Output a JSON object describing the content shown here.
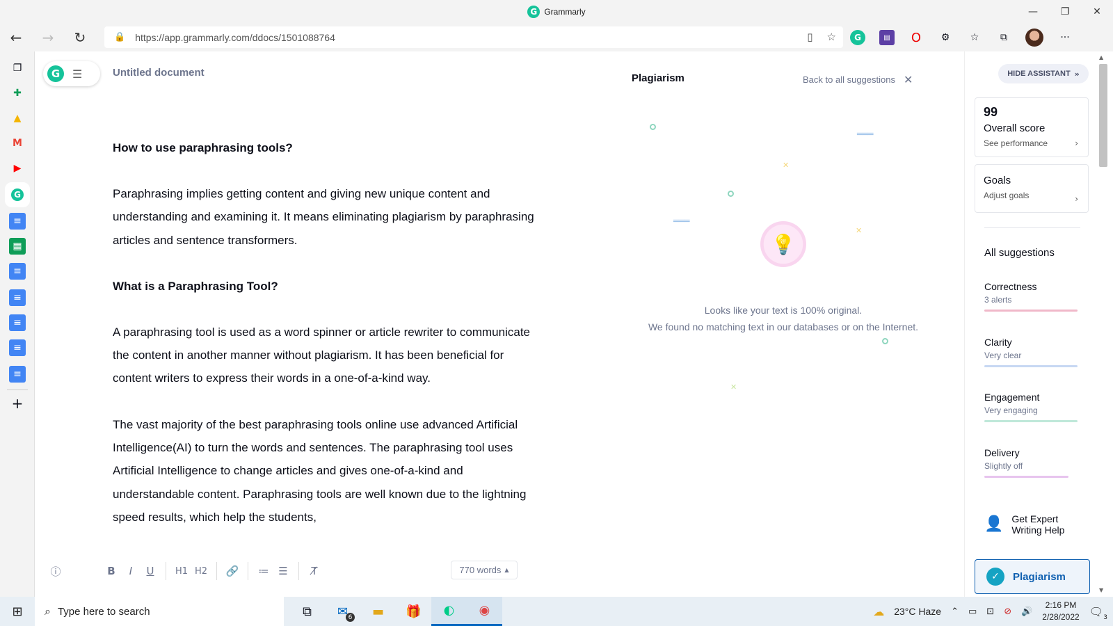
{
  "window": {
    "title": "Grammarly",
    "controls": [
      "—",
      "❐",
      "✕"
    ]
  },
  "browser": {
    "url": "https://app.grammarly.com/ddocs/1501088764",
    "back_icon": "←",
    "forward_icon": "→",
    "reload_icon": "↻",
    "more_icon": "···"
  },
  "extensions": [
    {
      "name": "grammarly-extension-icon",
      "glyph": "G"
    },
    {
      "name": "purple-extension-icon",
      "glyph": "▤"
    },
    {
      "name": "opera-extension-icon",
      "glyph": "O"
    },
    {
      "name": "puzzle-extension-icon",
      "glyph": "⚙"
    }
  ],
  "document": {
    "title": "Untitled document",
    "blocks": [
      {
        "type": "h",
        "text": "How to use paraphrasing tools?"
      },
      {
        "type": "p",
        "text": "Paraphrasing implies getting content and giving new unique content and understanding and examining it. It means eliminating plagiarism by paraphrasing articles and sentence transformers."
      },
      {
        "type": "h",
        "text": "What is a Paraphrasing Tool?"
      },
      {
        "type": "p",
        "text": "A  paraphrasing tool is used as a word spinner or article rewriter to communicate the content in another manner without plagiarism. It has been beneficial for content writers to express their words in a one-of-a-kind way."
      },
      {
        "type": "p",
        "text": "The vast majority of the best paraphrasing tools online use advanced Artificial Intelligence(AI) to turn the words and sentences. The paraphrasing tool uses Artificial Intelligence to change articles and gives one-of-a-kind and understandable content. Paraphrasing tools are well known due to the lightning speed results, which help the students,"
      }
    ],
    "word_count": "770 words",
    "toolbar": {
      "bold": "B",
      "italic": "I",
      "underline": "U",
      "h1": "H1",
      "h2": "H2"
    }
  },
  "plagiarism_panel": {
    "title": "Plagiarism",
    "back_link": "Back to all suggestions",
    "message_line1": "Looks like your text is 100% original.",
    "message_line2": "We found no matching text in our databases or on the Internet."
  },
  "assistant": {
    "hide_label": "HIDE ASSISTANT",
    "score": {
      "value": "99",
      "label": "Overall score",
      "link": "See performance"
    },
    "goals": {
      "label": "Goals",
      "link": "Adjust goals"
    },
    "all_suggestions": "All suggestions",
    "categories": [
      {
        "name": "Correctness",
        "desc": "3 alerts",
        "color": "#f0b8c9"
      },
      {
        "name": "Clarity",
        "desc": "Very clear",
        "color": "#c7d8f3"
      },
      {
        "name": "Engagement",
        "desc": "Very engaging",
        "color": "#bfe8d9"
      },
      {
        "name": "Delivery",
        "desc": "Slightly off",
        "color": "#e7c4ee"
      }
    ],
    "expert_line1": "Get Expert",
    "expert_line2": "Writing Help",
    "plagiarism_button": "Plagiarism"
  },
  "taskbar": {
    "search_placeholder": "Type here to search",
    "mail_badge": "6",
    "weather": "23°C  Haze",
    "time": "2:16 PM",
    "date": "2/28/2022",
    "notif_count": "3"
  },
  "colors": {
    "brand": "#15c39a",
    "accent_blue": "#0e5fb0"
  }
}
